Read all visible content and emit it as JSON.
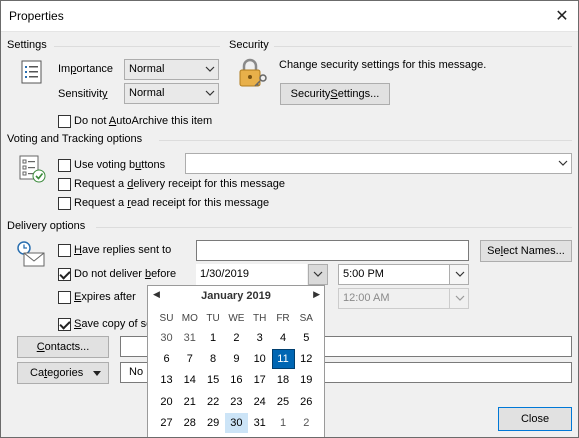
{
  "window": {
    "title": "Properties"
  },
  "settings": {
    "heading": "Settings",
    "importance_label_pre": "Im",
    "importance_label_u": "p",
    "importance_label_post": "ortance",
    "importance_value": "Normal",
    "sensitivity_label_pre": "Sensitivit",
    "sensitivity_label_u": "y",
    "sensitivity_value": "Normal",
    "archive_pre": "Do not ",
    "archive_u": "A",
    "archive_post": "utoArchive this item"
  },
  "security": {
    "heading": "Security",
    "description": "Change security settings for this message.",
    "button_pre": "Security ",
    "button_u": "S",
    "button_post": "ettings..."
  },
  "voting": {
    "heading": "Voting and Tracking options",
    "use_voting_pre": "Use voting b",
    "use_voting_u": "u",
    "use_voting_post": "ttons",
    "voting_value": "",
    "delivery_receipt_pre": "Request a ",
    "delivery_receipt_u": "d",
    "delivery_receipt_post": "elivery receipt for this message",
    "read_receipt_pre": "Request a ",
    "read_receipt_u": "r",
    "read_receipt_post": "ead receipt for this message"
  },
  "delivery": {
    "heading": "Delivery options",
    "replies_pre": "",
    "replies_u": "H",
    "replies_post": "ave replies sent to",
    "replies_value": "",
    "select_names_pre": "Se",
    "select_names_u": "l",
    "select_names_post": "ect Names...",
    "do_not_deliver_pre": "Do not deliver ",
    "do_not_deliver_u": "b",
    "do_not_deliver_post": "efore",
    "do_not_deliver_checked": true,
    "deliver_date": "1/30/2019",
    "deliver_time": "5:00 PM",
    "expires_pre": "",
    "expires_u": "E",
    "expires_post": "xpires after",
    "expires_checked": false,
    "expires_time": "12:00 AM",
    "save_copy_pre": "",
    "save_copy_u": "S",
    "save_copy_post": "ave copy of se",
    "save_copy_checked": true
  },
  "contacts_button_pre": "",
  "contacts_button_u": "C",
  "contacts_button_post": "ontacts...",
  "contacts_value": "",
  "categories_button_pre": "Ca",
  "categories_button_u": "t",
  "categories_button_post": "egories",
  "categories_value": "No",
  "close_button": "Close",
  "calendar": {
    "month": "January 2019",
    "weekdays": [
      "SU",
      "MO",
      "TU",
      "WE",
      "TH",
      "FR",
      "SA"
    ],
    "weeks": [
      [
        "30",
        "31",
        "1",
        "2",
        "3",
        "4",
        "5"
      ],
      [
        "6",
        "7",
        "8",
        "9",
        "10",
        "11",
        "12"
      ],
      [
        "13",
        "14",
        "15",
        "16",
        "17",
        "18",
        "19"
      ],
      [
        "20",
        "21",
        "22",
        "23",
        "24",
        "25",
        "26"
      ],
      [
        "27",
        "28",
        "29",
        "30",
        "31",
        "1",
        "2"
      ]
    ],
    "today": "11",
    "selected": "30"
  },
  "colors": {
    "accent": "#0066b3",
    "selected": "#cce4f7"
  }
}
